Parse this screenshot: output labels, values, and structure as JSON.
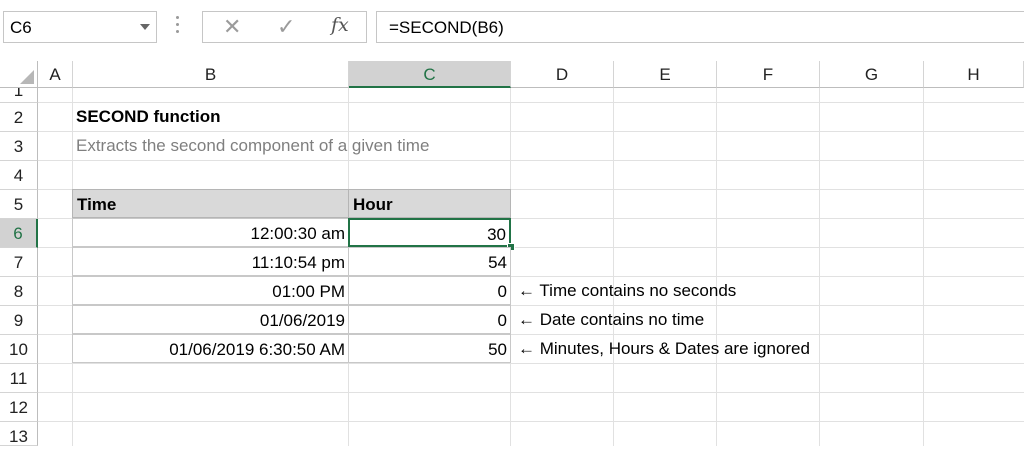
{
  "formula_bar": {
    "name_box": "C6",
    "cancel_icon": "✕",
    "enter_icon": "✓",
    "function_icon": "fx",
    "formula": "=SECOND(B6)"
  },
  "columns": [
    "A",
    "B",
    "C",
    "D",
    "E",
    "F",
    "G",
    "H"
  ],
  "rows": [
    "1",
    "2",
    "3",
    "4",
    "5",
    "6",
    "7",
    "8",
    "9",
    "10",
    "11",
    "12",
    "13"
  ],
  "selected_column": "C",
  "selected_row": "6",
  "title": "SECOND function",
  "subtitle": "Extracts the second component of a given time",
  "table": {
    "headers": [
      "Time",
      "Hour"
    ],
    "rows": [
      {
        "time": "12:00:30 am",
        "value": "30",
        "note": ""
      },
      {
        "time": "11:10:54 pm",
        "value": "54",
        "note": ""
      },
      {
        "time": "01:00 PM",
        "value": "0",
        "note": "← Time contains no seconds"
      },
      {
        "time": "01/06/2019",
        "value": "0",
        "note": "← Date contains no time"
      },
      {
        "time": "01/06/2019 6:30:50 AM",
        "value": "50",
        "note": "← Minutes, Hours & Dates are ignored"
      }
    ]
  },
  "colors": {
    "accent": "#217346",
    "header_fill": "#d9d9d9",
    "subtitle_text": "#7f7f7f"
  }
}
